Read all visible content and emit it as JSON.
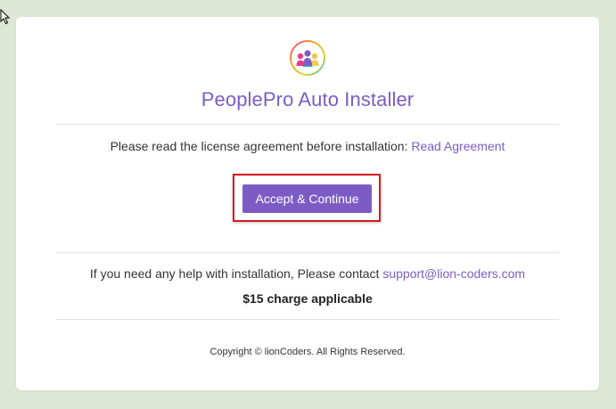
{
  "installer": {
    "title": "PeoplePro Auto Installer",
    "license_text": "Please read the license agreement before installation:",
    "license_link": "Read Agreement",
    "accept_button": "Accept & Continue",
    "help_text": "If you need any help with installation, Please contact",
    "support_email": "support@lion-coders.com",
    "charge_text": "$15 charge applicable",
    "copyright": "Copyright © lionCoders. All Rights Reserved."
  },
  "icons": {
    "logo": "peoplepro-logo-icon",
    "cursor": "mouse-pointer-icon"
  },
  "colors": {
    "background": "#dde7d3",
    "accent": "#7c5cc4",
    "highlight": "#d51c1c"
  }
}
